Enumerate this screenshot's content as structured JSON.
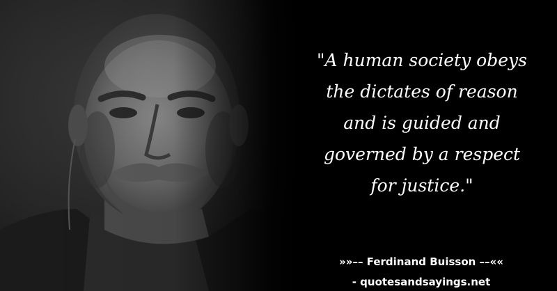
{
  "quote": {
    "lines": [
      "\"A human society obeys",
      "the dictates of reason",
      "and is guided and",
      "governed by a respect",
      "for justice.\""
    ]
  },
  "attribution": {
    "author": "»»–– Ferdinand Buisson ––««",
    "source": "- quotesandsayings.net"
  },
  "colors": {
    "background": "#000000",
    "text": "#ffffff"
  }
}
